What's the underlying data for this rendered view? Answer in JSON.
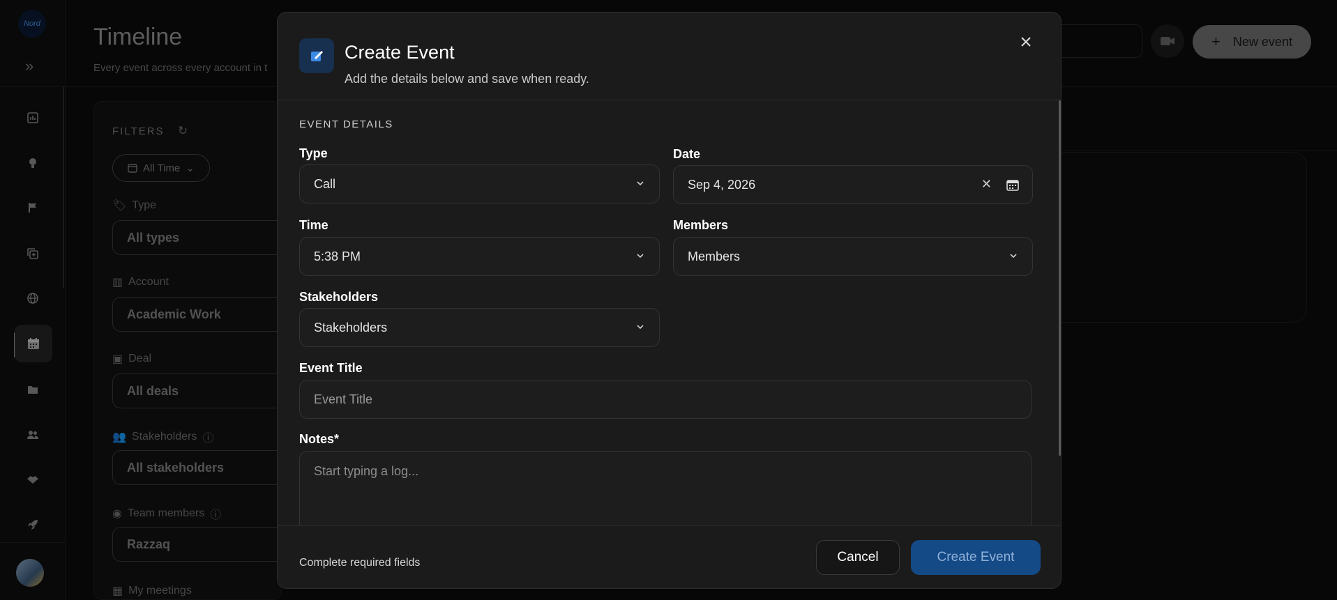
{
  "app": {
    "logo_text": "Nord",
    "page_title": "Timeline",
    "page_subtitle": "Every event across every account in t",
    "new_event_label": "New event",
    "colors": {
      "accent": "#144a86",
      "modal_bg": "#1b1b1b",
      "page_bg": "#0b0b0b"
    }
  },
  "sidebar": {
    "items": [
      {
        "icon": "reports-icon"
      },
      {
        "icon": "lightbulb-icon"
      },
      {
        "icon": "flag-icon"
      },
      {
        "icon": "add-copy-icon"
      },
      {
        "icon": "globe-icon"
      },
      {
        "icon": "calendar-icon",
        "active": true
      },
      {
        "icon": "folder-icon"
      },
      {
        "icon": "people-icon"
      },
      {
        "icon": "handshake-icon"
      },
      {
        "icon": "rocket-icon"
      }
    ]
  },
  "filters": {
    "title": "FILTERS",
    "time_pill": "All Time",
    "type_label": "Type",
    "type_value": "All types",
    "account_label": "Account",
    "account_value": "Academic Work",
    "deal_label": "Deal",
    "deal_value": "All deals",
    "stakeholders_label": "Stakeholders",
    "stakeholders_value": "All stakeholders",
    "team_label": "Team members",
    "team_value": "Razzaq",
    "meetings_label": "My meetings"
  },
  "modal": {
    "title": "Create Event",
    "subtitle": "Add the details below and save when ready.",
    "section_title": "EVENT DETAILS",
    "type_label": "Type",
    "type_value": "Call",
    "date_label": "Date",
    "date_value": "Sep 4, 2026",
    "time_label": "Time",
    "time_value": "5:38 PM",
    "members_label": "Members",
    "members_value": "Members",
    "stakeholders_label": "Stakeholders",
    "stakeholders_value": "Stakeholders",
    "event_title_label": "Event Title",
    "event_title_placeholder": "Event Title",
    "notes_label": "Notes*",
    "notes_placeholder": "Start typing a log...",
    "footer_note": "Complete required fields",
    "cancel_label": "Cancel",
    "create_label": "Create Event"
  }
}
